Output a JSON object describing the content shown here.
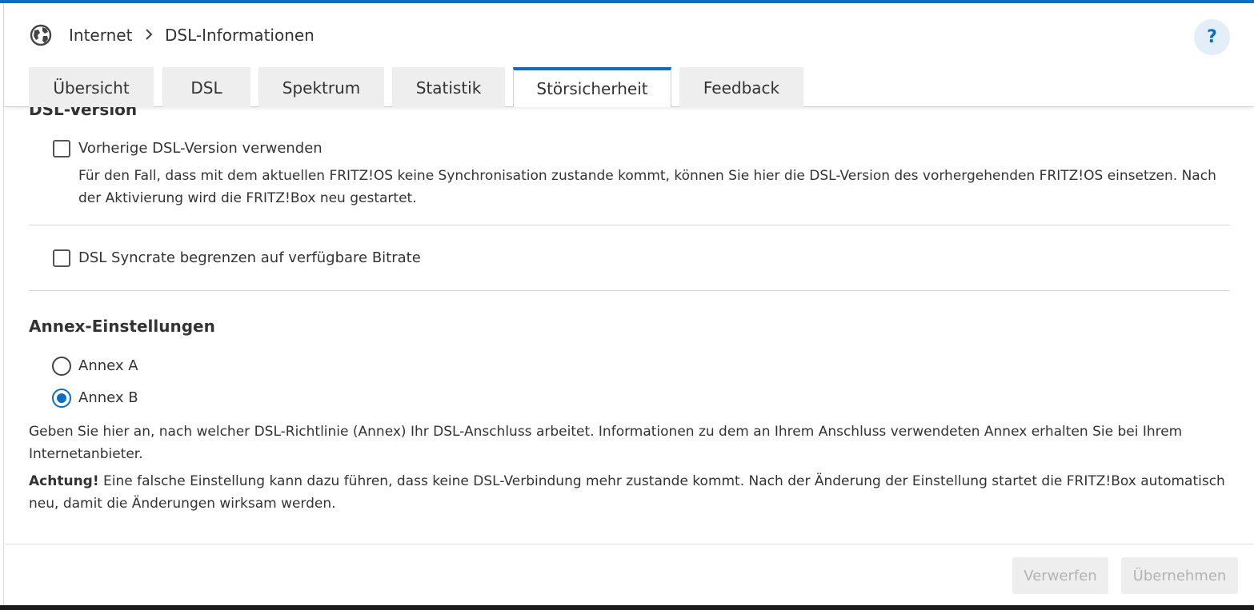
{
  "breadcrumb": {
    "level1": "Internet",
    "level2": "DSL-Informationen"
  },
  "help_label": "?",
  "tabs": [
    {
      "label": "Übersicht",
      "active": false
    },
    {
      "label": "DSL",
      "active": false
    },
    {
      "label": "Spektrum",
      "active": false
    },
    {
      "label": "Statistik",
      "active": false
    },
    {
      "label": "Störsicherheit",
      "active": true
    },
    {
      "label": "Feedback",
      "active": false
    }
  ],
  "dsl_version": {
    "section_title": "DSL-Version",
    "prev_version_label": "Vorherige DSL-Version verwenden",
    "prev_version_checked": false,
    "prev_version_desc": "Für den Fall, dass mit dem aktuellen FRITZ!OS keine Synchronisation zustande kommt, können Sie hier die DSL-Version des vorhergehenden FRITZ!OS einsetzen. Nach der Aktivierung wird die FRITZ!Box neu gestartet.",
    "syncrate_label": "DSL Syncrate begrenzen auf verfügbare Bitrate",
    "syncrate_checked": false
  },
  "annex": {
    "section_title": "Annex-Einstellungen",
    "option_a": "Annex A",
    "option_b": "Annex B",
    "selected": "Annex B",
    "info": "Geben Sie hier an, nach welcher DSL-Richtlinie (Annex) Ihr DSL-Anschluss arbeitet. Informationen zu dem an Ihrem Anschluss verwendeten Annex erhalten Sie bei Ihrem Internetanbieter.",
    "warning_bold": "Achtung!",
    "warning_text": " Eine falsche Einstellung kann dazu führen, dass keine DSL-Verbindung mehr zustande kommt. Nach der Änderung der Einstellung startet die FRITZ!Box automatisch neu, damit die Änderungen wirksam werden."
  },
  "footer": {
    "discard_label": "Verwerfen",
    "apply_label": "Übernehmen"
  },
  "colors": {
    "accent": "#0a6fc2",
    "tab_bg": "#eeeeee",
    "disabled_text": "#b3b3b3"
  }
}
